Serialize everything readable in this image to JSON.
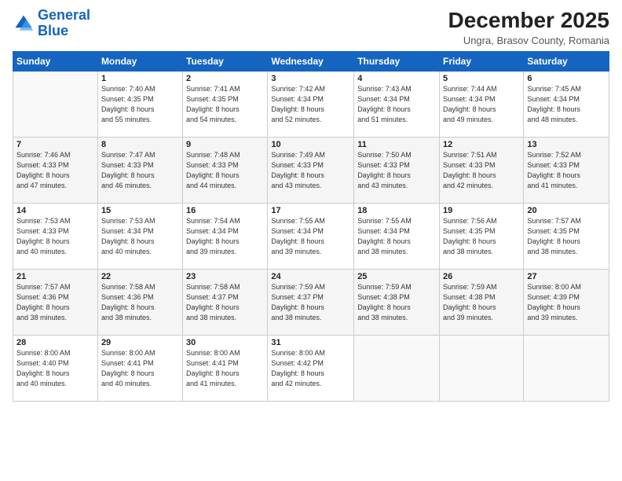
{
  "logo": {
    "line1": "General",
    "line2": "Blue"
  },
  "title": "December 2025",
  "location": "Ungra, Brasov County, Romania",
  "weekdays": [
    "Sunday",
    "Monday",
    "Tuesday",
    "Wednesday",
    "Thursday",
    "Friday",
    "Saturday"
  ],
  "weeks": [
    [
      {
        "day": "",
        "sunrise": "",
        "sunset": "",
        "daylight": ""
      },
      {
        "day": "1",
        "sunrise": "Sunrise: 7:40 AM",
        "sunset": "Sunset: 4:35 PM",
        "daylight": "Daylight: 8 hours and 55 minutes."
      },
      {
        "day": "2",
        "sunrise": "Sunrise: 7:41 AM",
        "sunset": "Sunset: 4:35 PM",
        "daylight": "Daylight: 8 hours and 54 minutes."
      },
      {
        "day": "3",
        "sunrise": "Sunrise: 7:42 AM",
        "sunset": "Sunset: 4:34 PM",
        "daylight": "Daylight: 8 hours and 52 minutes."
      },
      {
        "day": "4",
        "sunrise": "Sunrise: 7:43 AM",
        "sunset": "Sunset: 4:34 PM",
        "daylight": "Daylight: 8 hours and 51 minutes."
      },
      {
        "day": "5",
        "sunrise": "Sunrise: 7:44 AM",
        "sunset": "Sunset: 4:34 PM",
        "daylight": "Daylight: 8 hours and 49 minutes."
      },
      {
        "day": "6",
        "sunrise": "Sunrise: 7:45 AM",
        "sunset": "Sunset: 4:34 PM",
        "daylight": "Daylight: 8 hours and 48 minutes."
      }
    ],
    [
      {
        "day": "7",
        "sunrise": "Sunrise: 7:46 AM",
        "sunset": "Sunset: 4:33 PM",
        "daylight": "Daylight: 8 hours and 47 minutes."
      },
      {
        "day": "8",
        "sunrise": "Sunrise: 7:47 AM",
        "sunset": "Sunset: 4:33 PM",
        "daylight": "Daylight: 8 hours and 46 minutes."
      },
      {
        "day": "9",
        "sunrise": "Sunrise: 7:48 AM",
        "sunset": "Sunset: 4:33 PM",
        "daylight": "Daylight: 8 hours and 44 minutes."
      },
      {
        "day": "10",
        "sunrise": "Sunrise: 7:49 AM",
        "sunset": "Sunset: 4:33 PM",
        "daylight": "Daylight: 8 hours and 43 minutes."
      },
      {
        "day": "11",
        "sunrise": "Sunrise: 7:50 AM",
        "sunset": "Sunset: 4:33 PM",
        "daylight": "Daylight: 8 hours and 43 minutes."
      },
      {
        "day": "12",
        "sunrise": "Sunrise: 7:51 AM",
        "sunset": "Sunset: 4:33 PM",
        "daylight": "Daylight: 8 hours and 42 minutes."
      },
      {
        "day": "13",
        "sunrise": "Sunrise: 7:52 AM",
        "sunset": "Sunset: 4:33 PM",
        "daylight": "Daylight: 8 hours and 41 minutes."
      }
    ],
    [
      {
        "day": "14",
        "sunrise": "Sunrise: 7:53 AM",
        "sunset": "Sunset: 4:33 PM",
        "daylight": "Daylight: 8 hours and 40 minutes."
      },
      {
        "day": "15",
        "sunrise": "Sunrise: 7:53 AM",
        "sunset": "Sunset: 4:34 PM",
        "daylight": "Daylight: 8 hours and 40 minutes."
      },
      {
        "day": "16",
        "sunrise": "Sunrise: 7:54 AM",
        "sunset": "Sunset: 4:34 PM",
        "daylight": "Daylight: 8 hours and 39 minutes."
      },
      {
        "day": "17",
        "sunrise": "Sunrise: 7:55 AM",
        "sunset": "Sunset: 4:34 PM",
        "daylight": "Daylight: 8 hours and 39 minutes."
      },
      {
        "day": "18",
        "sunrise": "Sunrise: 7:55 AM",
        "sunset": "Sunset: 4:34 PM",
        "daylight": "Daylight: 8 hours and 38 minutes."
      },
      {
        "day": "19",
        "sunrise": "Sunrise: 7:56 AM",
        "sunset": "Sunset: 4:35 PM",
        "daylight": "Daylight: 8 hours and 38 minutes."
      },
      {
        "day": "20",
        "sunrise": "Sunrise: 7:57 AM",
        "sunset": "Sunset: 4:35 PM",
        "daylight": "Daylight: 8 hours and 38 minutes."
      }
    ],
    [
      {
        "day": "21",
        "sunrise": "Sunrise: 7:57 AM",
        "sunset": "Sunset: 4:36 PM",
        "daylight": "Daylight: 8 hours and 38 minutes."
      },
      {
        "day": "22",
        "sunrise": "Sunrise: 7:58 AM",
        "sunset": "Sunset: 4:36 PM",
        "daylight": "Daylight: 8 hours and 38 minutes."
      },
      {
        "day": "23",
        "sunrise": "Sunrise: 7:58 AM",
        "sunset": "Sunset: 4:37 PM",
        "daylight": "Daylight: 8 hours and 38 minutes."
      },
      {
        "day": "24",
        "sunrise": "Sunrise: 7:59 AM",
        "sunset": "Sunset: 4:37 PM",
        "daylight": "Daylight: 8 hours and 38 minutes."
      },
      {
        "day": "25",
        "sunrise": "Sunrise: 7:59 AM",
        "sunset": "Sunset: 4:38 PM",
        "daylight": "Daylight: 8 hours and 38 minutes."
      },
      {
        "day": "26",
        "sunrise": "Sunrise: 7:59 AM",
        "sunset": "Sunset: 4:38 PM",
        "daylight": "Daylight: 8 hours and 39 minutes."
      },
      {
        "day": "27",
        "sunrise": "Sunrise: 8:00 AM",
        "sunset": "Sunset: 4:39 PM",
        "daylight": "Daylight: 8 hours and 39 minutes."
      }
    ],
    [
      {
        "day": "28",
        "sunrise": "Sunrise: 8:00 AM",
        "sunset": "Sunset: 4:40 PM",
        "daylight": "Daylight: 8 hours and 40 minutes."
      },
      {
        "day": "29",
        "sunrise": "Sunrise: 8:00 AM",
        "sunset": "Sunset: 4:41 PM",
        "daylight": "Daylight: 8 hours and 40 minutes."
      },
      {
        "day": "30",
        "sunrise": "Sunrise: 8:00 AM",
        "sunset": "Sunset: 4:41 PM",
        "daylight": "Daylight: 8 hours and 41 minutes."
      },
      {
        "day": "31",
        "sunrise": "Sunrise: 8:00 AM",
        "sunset": "Sunset: 4:42 PM",
        "daylight": "Daylight: 8 hours and 42 minutes."
      },
      {
        "day": "",
        "sunrise": "",
        "sunset": "",
        "daylight": ""
      },
      {
        "day": "",
        "sunrise": "",
        "sunset": "",
        "daylight": ""
      },
      {
        "day": "",
        "sunrise": "",
        "sunset": "",
        "daylight": ""
      }
    ]
  ]
}
